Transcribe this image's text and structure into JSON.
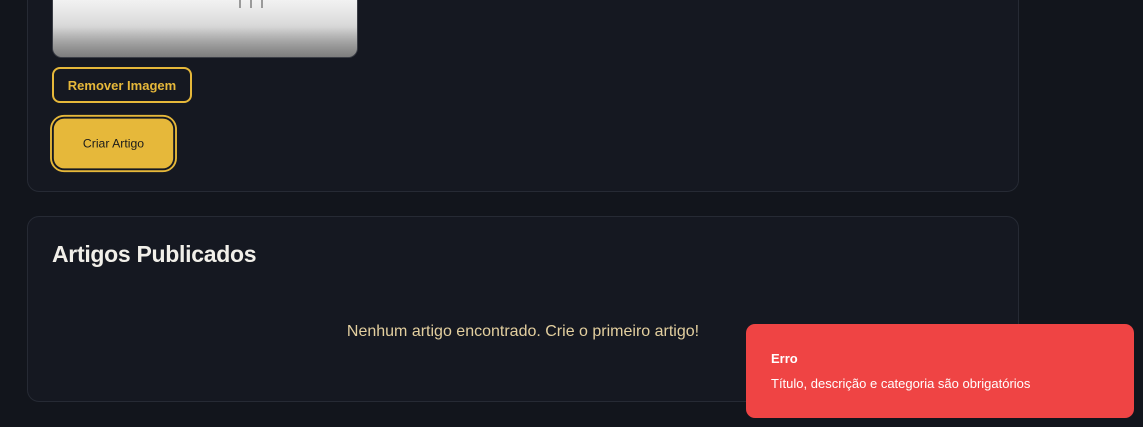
{
  "upload": {
    "remove_image_label": "Remover Imagem",
    "create_article_label": "Criar Artigo"
  },
  "articles": {
    "title": "Artigos Publicados",
    "empty_message": "Nenhum artigo encontrado. Crie o primeiro artigo!"
  },
  "toast": {
    "title": "Erro",
    "message": "Título, descrição e categoria são obrigatórios",
    "color": "#ef4444"
  },
  "colors": {
    "accent": "#e6b83a",
    "background": "#12151c",
    "card": "#151821"
  }
}
